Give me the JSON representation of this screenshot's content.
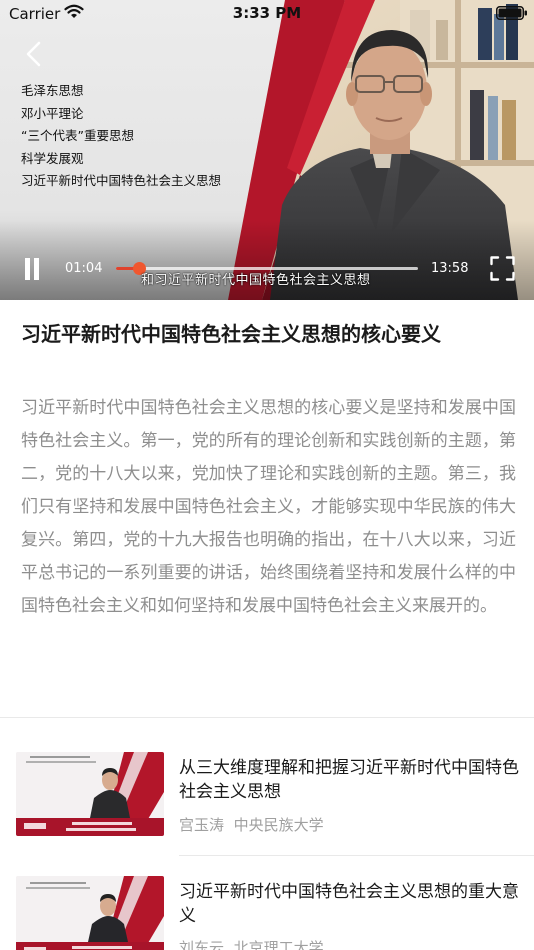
{
  "status_bar": {
    "carrier": "Carrier",
    "time": "3:33 PM"
  },
  "player": {
    "topics": [
      "毛泽东思想",
      "邓小平理论",
      "“三个代表”重要思想",
      "科学发展观",
      "习近平新时代中国特色社会主义思想"
    ],
    "current_time": "01:04",
    "total_time": "13:58",
    "progress": 0.077,
    "subtitle": "和习近平新时代中国特色社会主义思想",
    "accent_color": "#e0432d",
    "brand_red": "#b3162a"
  },
  "article": {
    "title": "习近平新时代中国特色社会主义思想的核心要义",
    "body": "习近平新时代中国特色社会主义思想的核心要义是坚持和发展中国特色社会主义。第一，党的所有的理论创新和实践创新的主题，第二，党的十八大以来，党加快了理论和实践创新的主题。第三，我们只有坚持和发展中国特色社会主义，才能够实现中华民族的伟大复兴。第四，党的十九大报告也明确的指出，在十八大以来，习近平总书记的一系列重要的讲话，始终围绕着坚持和发展什么样的中国特色社会主义和如何坚持和发展中国特色社会主义来展开的。"
  },
  "related": [
    {
      "title": "从三大维度理解和把握习近平新时代中国特色社会主义思想",
      "author": "宫玉涛",
      "org": "中央民族大学"
    },
    {
      "title": "习近平新时代中国特色社会主义思想的重大意义",
      "author": "刘东云",
      "org": "北京理工大学"
    }
  ],
  "icons": {
    "back": "chevron-left-icon",
    "pause": "pause-icon",
    "fullscreen": "fullscreen-icon",
    "wifi": "wifi-icon",
    "battery": "battery-icon"
  }
}
